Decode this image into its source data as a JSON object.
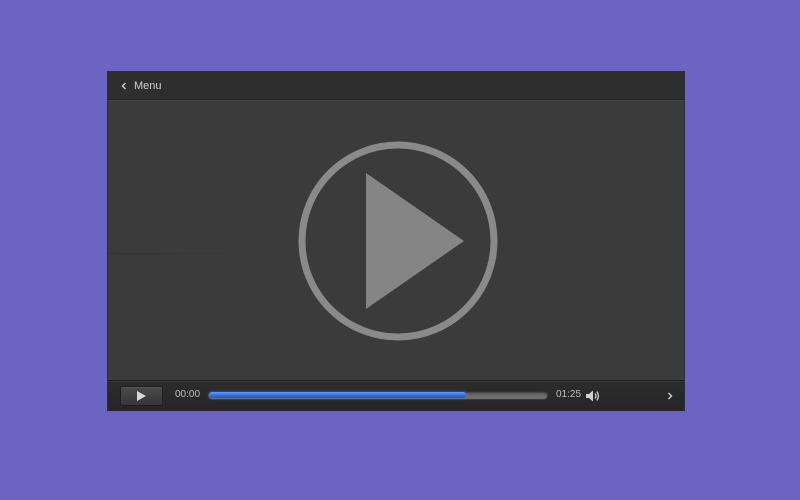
{
  "topbar": {
    "menu_label": "Menu",
    "back_icon": "chevron-left-icon"
  },
  "stage": {
    "center_icon": "play-circle-icon"
  },
  "controls": {
    "play_icon": "play-icon",
    "current_time": "00:00",
    "total_time": "01:25",
    "progress_fraction": 0.76,
    "volume_icon": "speaker-icon",
    "next_icon": "chevron-right-icon"
  },
  "colors": {
    "background": "#6b64c2",
    "player": "#3b3b3b",
    "progress_fill": "#2f6ee6",
    "icon": "#8a8a8a"
  }
}
